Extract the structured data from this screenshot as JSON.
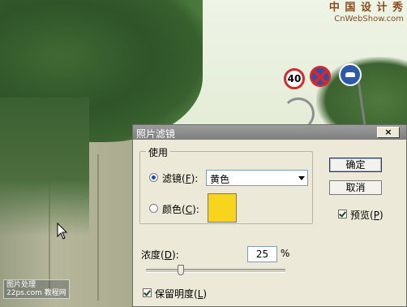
{
  "background": {
    "watermark_top_line1": "中 国 设 计 秀",
    "watermark_top_line2": "CnWebShow.com",
    "watermark_bottom": "图片处理\n22ps.com 教程网",
    "speed_sign": "40"
  },
  "dialog": {
    "title": "照片滤镜",
    "close_label": "×",
    "use_group_label": "使用",
    "filter_radio": {
      "label": "滤镜",
      "mnemonic": "F",
      "checked": true
    },
    "filter_select_value": "黄色",
    "color_radio": {
      "label": "颜色",
      "mnemonic": "C",
      "checked": false
    },
    "color_swatch": "#f6d51c",
    "density": {
      "label": "浓度",
      "mnemonic": "D",
      "value": "25",
      "unit": "%",
      "slider_fraction": 0.25
    },
    "preserve_luminosity": {
      "label": "保留明度",
      "mnemonic": "L",
      "checked": true
    },
    "buttons": {
      "ok": "确定",
      "cancel": "取消"
    },
    "preview": {
      "label": "预览",
      "mnemonic": "P",
      "checked": true
    }
  }
}
